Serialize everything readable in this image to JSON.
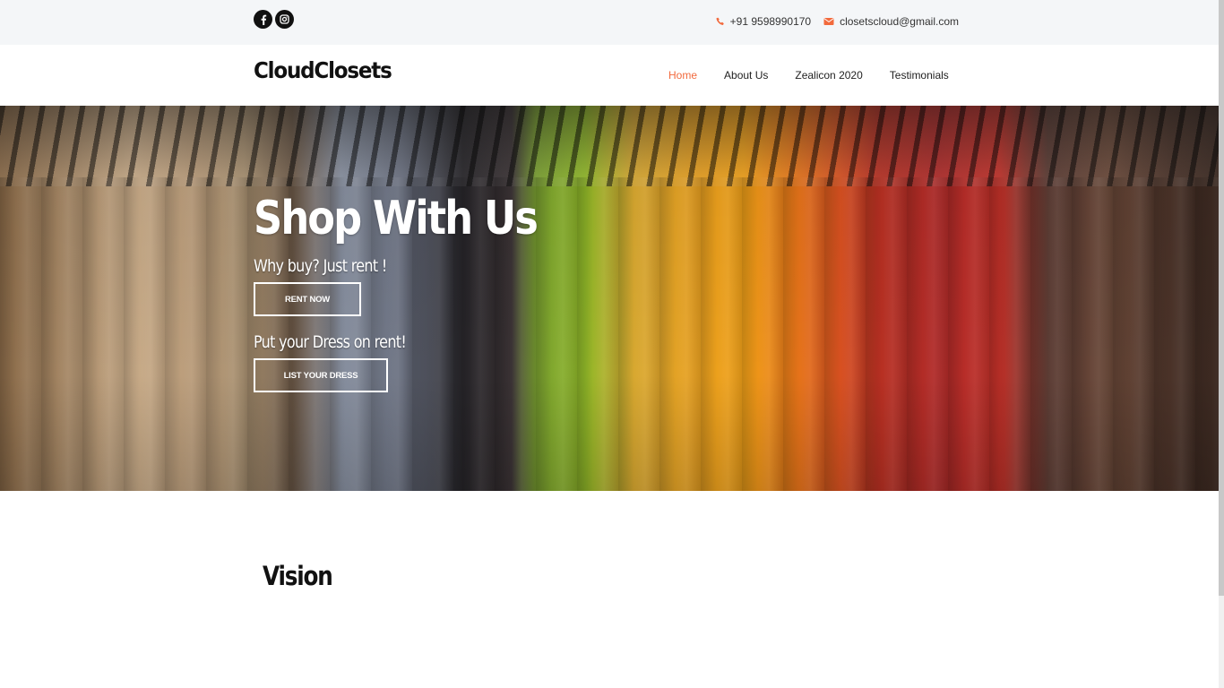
{
  "topbar": {
    "social": [
      {
        "icon": "facebook-icon",
        "glyph": "f"
      },
      {
        "icon": "instagram-icon",
        "glyph": ""
      }
    ],
    "phone": "+91 9598990170",
    "email": "closetscloud@gmail.com",
    "accent_color": "#f26a3d"
  },
  "nav": {
    "brand": "CloudClosets",
    "items": [
      {
        "label": "Home",
        "active": true
      },
      {
        "label": "About Us",
        "active": false
      },
      {
        "label": "Zealicon 2020",
        "active": false
      },
      {
        "label": "Testimonials",
        "active": false
      }
    ]
  },
  "hero": {
    "title": "Shop With Us",
    "subtitle_1": "Why buy? Just rent !",
    "button_1": "RENT NOW",
    "subtitle_2": "Put your Dress on rent!",
    "button_2": "LIST YOUR DRESS"
  },
  "vision": {
    "heading": "Vision"
  }
}
